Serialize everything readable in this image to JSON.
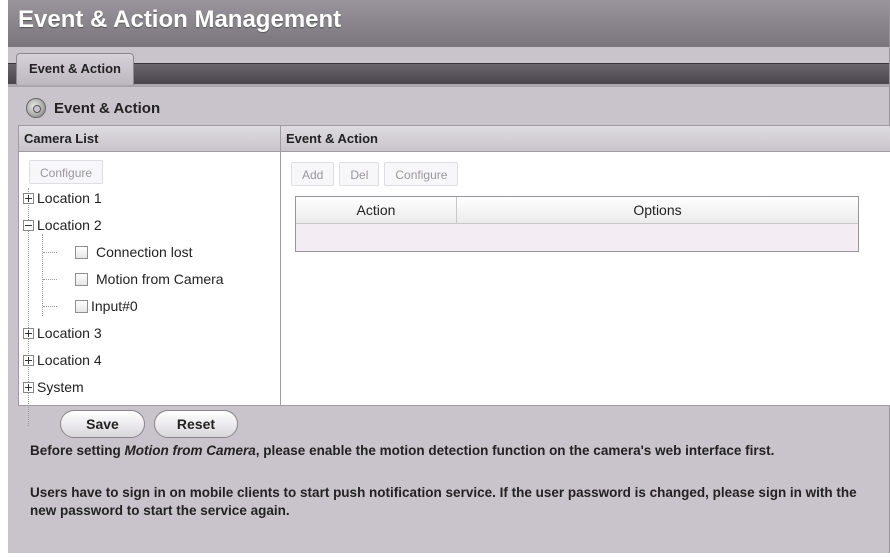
{
  "header": {
    "title": "Event & Action Management"
  },
  "tabs": [
    {
      "label": "Event & Action",
      "active": true
    }
  ],
  "section": {
    "title": "Event & Action",
    "icon": "gear-icon"
  },
  "camera_panel": {
    "header": "Camera List",
    "configure_label": "Configure",
    "tree": {
      "location1": "Location 1",
      "location2": "Location 2",
      "location2_children": {
        "connection_lost": "Connection lost",
        "motion_from_camera": "Motion from Camera",
        "input0": "Input#0"
      },
      "location3": "Location 3",
      "location4": "Location 4",
      "system": "System"
    }
  },
  "event_panel": {
    "header": "Event & Action",
    "add_label": "Add",
    "del_label": "Del",
    "configure_label": "Configure",
    "table": {
      "columns": [
        "Action",
        "Options"
      ],
      "rows": []
    }
  },
  "footer": {
    "save_label": "Save",
    "reset_label": "Reset",
    "note1_prefix": "Before setting ",
    "note1_em": "Motion from Camera",
    "note1_suffix": ", please enable the motion detection function on the camera's web interface first.",
    "note2": "Users have to sign in on mobile clients to start push notification service. If the user password is changed, please sign in with the new password to start the service again."
  },
  "colors": {
    "window_bg": "#c9c3cb",
    "title_bg": "#8a848c",
    "panel_bg": "#ffffff",
    "row_bg": "#f3ecf3"
  }
}
